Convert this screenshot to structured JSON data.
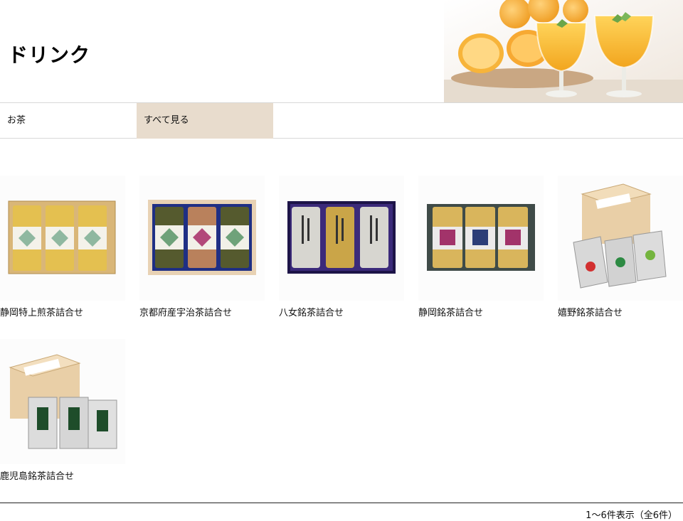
{
  "page": {
    "title": "ドリンク"
  },
  "tabs": [
    {
      "label": "お茶",
      "active": false
    },
    {
      "label": "すべて見る",
      "active": true
    }
  ],
  "products": [
    {
      "name": "静岡特上煎茶詰合せ"
    },
    {
      "name": "京都府産宇治茶詰合せ"
    },
    {
      "name": "八女銘茶詰合せ"
    },
    {
      "name": "静岡銘茶詰合せ"
    },
    {
      "name": "嬉野銘茶詰合せ"
    },
    {
      "name": "鹿児島銘茶詰合せ"
    }
  ],
  "pagination": {
    "summary": "1～6件表示（全6件）"
  },
  "colors": {
    "active_tab": "#e8dccd",
    "divider": "#222222"
  }
}
